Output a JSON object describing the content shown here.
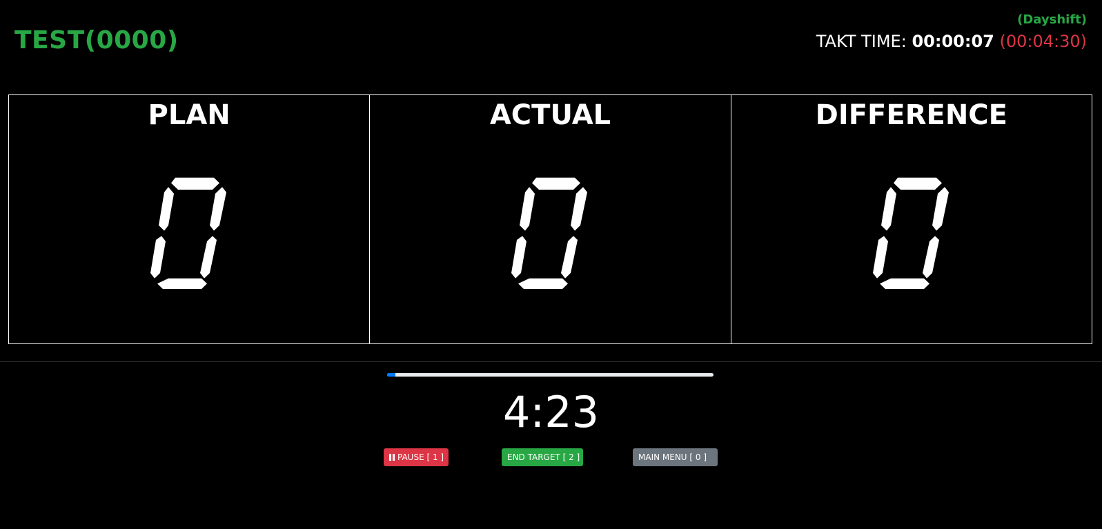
{
  "header": {
    "line_title": "TEST(0000)",
    "shift": "(Dayshift)",
    "takt_label": "TAKT TIME:",
    "takt_current": "00:00:07",
    "takt_target": "(00:04:30)"
  },
  "boards": [
    {
      "title": "PLAN",
      "value": "0"
    },
    {
      "title": "ACTUAL",
      "value": "0"
    },
    {
      "title": "DIFFERENCE",
      "value": "0"
    }
  ],
  "progress": {
    "fraction": 0.025
  },
  "timer": "4:23",
  "buttons": {
    "pause": "PAUSE [ 1 ]",
    "end_target": "END TARGET [ 2 ]",
    "main_menu": "MAIN MENU [ 0 ]"
  },
  "icons": {
    "pause": "pause-icon"
  },
  "colors": {
    "green": "#28a745",
    "red": "#dc3545",
    "gray": "#6c757d",
    "blue": "#007bff"
  }
}
